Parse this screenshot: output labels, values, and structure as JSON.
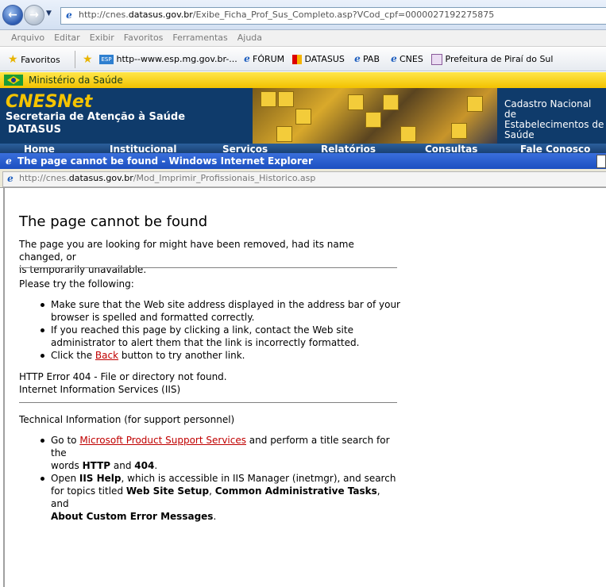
{
  "browser": {
    "address_prefix": "http://cnes.",
    "address_host": "datasus.gov.br",
    "address_path": "/Exibe_Ficha_Prof_Sus_Completo.asp?VCod_cpf=0000027192275875",
    "menu": [
      "Arquivo",
      "Editar",
      "Exibir",
      "Favoritos",
      "Ferramentas",
      "Ajuda"
    ],
    "favorites_label": "Favoritos",
    "favorites_links": [
      "http--www.esp.mg.gov.br-...",
      "FÓRUM",
      "DATASUS",
      "PAB",
      "CNES",
      "Prefeitura de Piraí do Sul"
    ]
  },
  "site": {
    "ministry": "Ministério da Saúde",
    "brand": "CNESNet",
    "secretaria": "Secretaria de Atenção à Saúde",
    "datasus": "DATASUS",
    "cadastro_line1": "Cadastro Nacional de",
    "cadastro_line2": "Estabelecimentos de",
    "cadastro_line3": "Saúde",
    "nav": [
      "Home",
      "Institucional",
      "Serviços",
      "Relatórios",
      "Consultas",
      "Fale Conosco"
    ]
  },
  "popup": {
    "title": "The page cannot be found - Windows Internet Explorer",
    "address_prefix": "http://cnes.",
    "address_host": "datasus.gov.br",
    "address_path": "/Mod_Imprimir_Profissionais_Historico.asp"
  },
  "error": {
    "heading": "The page cannot be found",
    "intro_1": "The page you are looking for might have been removed, had its name changed, or",
    "intro_2": "is temporarily unavailable.",
    "try_label": "Please try the following:",
    "tip1_l1": "Make sure that the Web site address displayed in the address bar of your",
    "tip1_l2": "browser is spelled and formatted correctly.",
    "tip2_l1": "If you reached this page by clicking a link, contact the Web site",
    "tip2_l2": "administrator to alert them that the link is incorrectly formatted.",
    "tip3_pre": "Click the ",
    "tip3_link": "Back",
    "tip3_post": " button to try another link.",
    "http_error": "HTTP Error 404 - File or directory not found.",
    "iis": "Internet Information Services (IIS)",
    "tech_label": "Technical Information (for support personnel)",
    "tech1_pre": "Go to ",
    "tech1_link": "Microsoft Product Support Services",
    "tech1_mid": " and perform a title search for the",
    "tech1_l2_pre": "words ",
    "tech1_b1": "HTTP",
    "tech1_and": " and ",
    "tech1_b2": "404",
    "tech1_end": ".",
    "tech2_pre": "Open ",
    "tech2_b1": "IIS Help",
    "tech2_mid": ", which is accessible in IIS Manager (inetmgr), and search",
    "tech2_l2_pre": "for topics titled ",
    "tech2_b2": "Web Site Setup",
    "tech2_comma": ", ",
    "tech2_b3": "Common Administrative Tasks",
    "tech2_and": ", and",
    "tech2_b4": "About Custom Error Messages",
    "tech2_end": "."
  }
}
